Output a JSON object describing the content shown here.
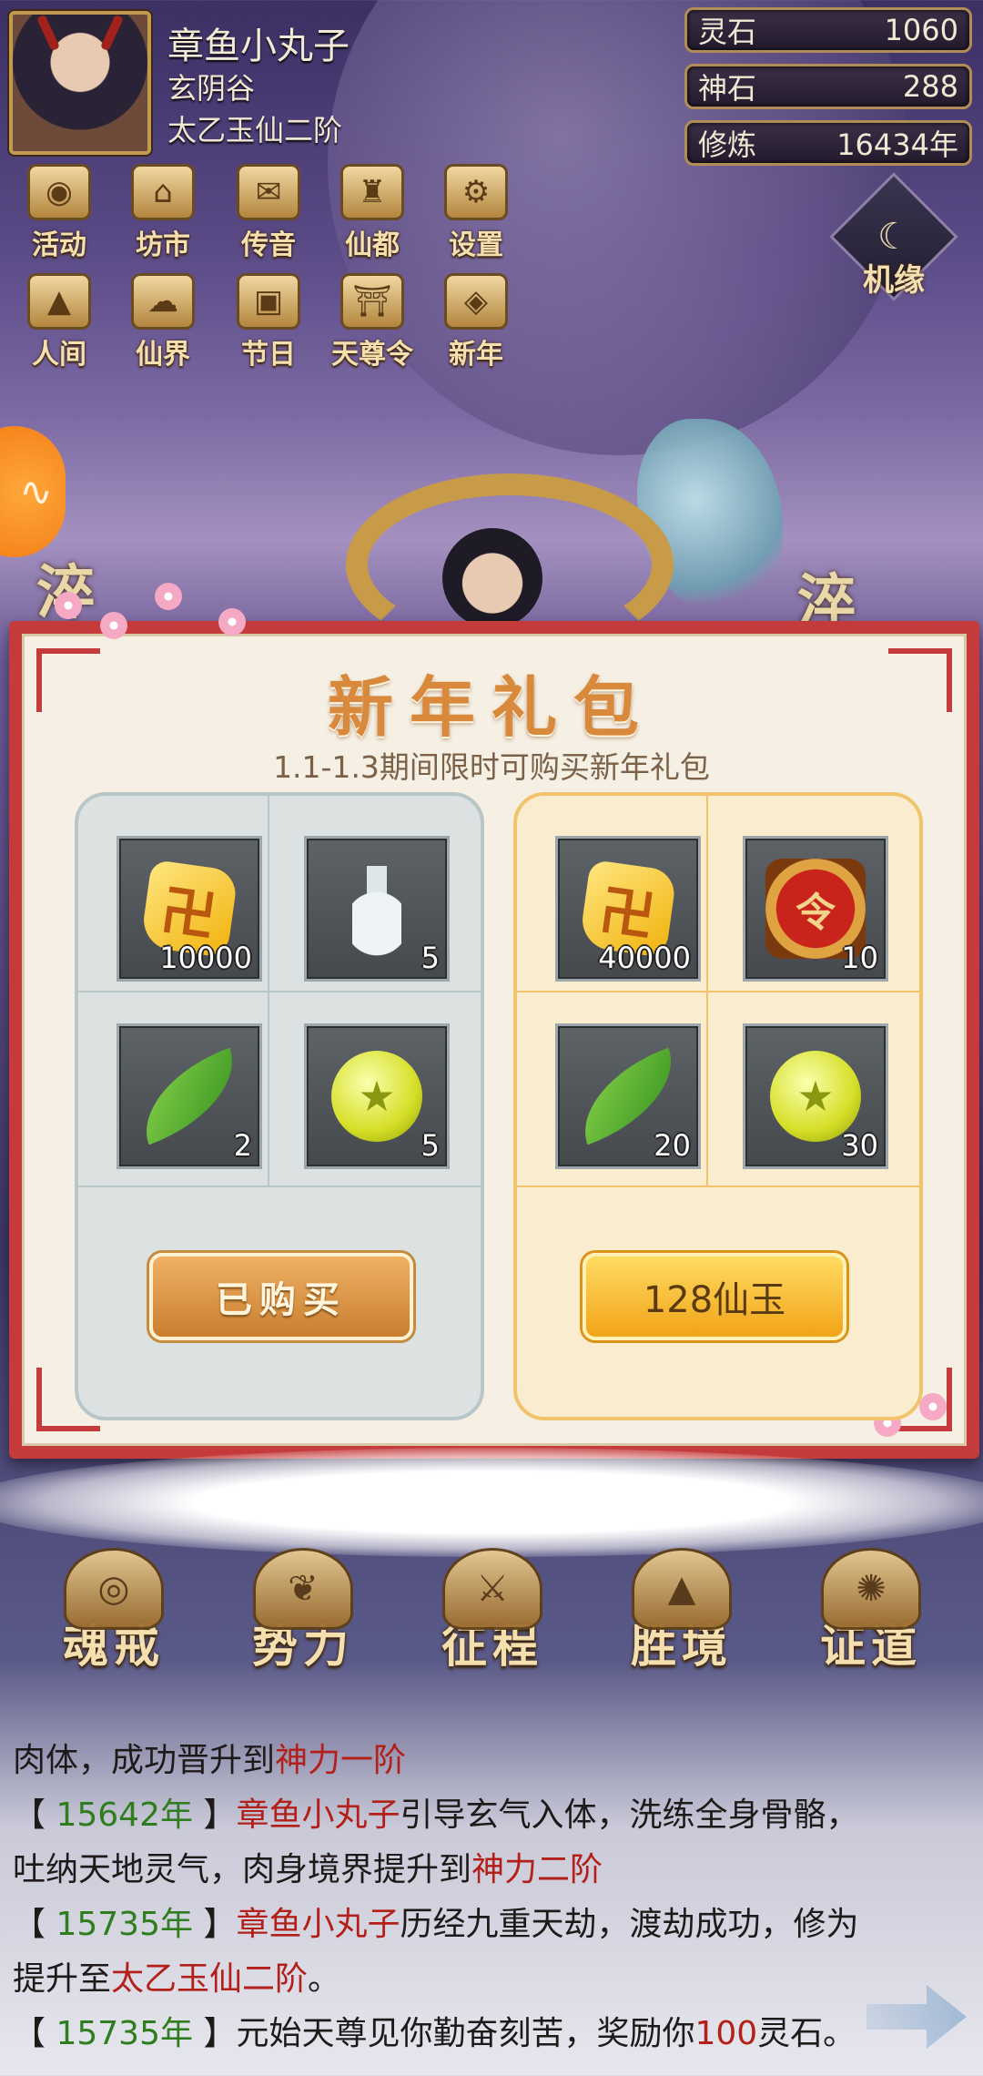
{
  "player": {
    "name": "章鱼小丸子",
    "sect": "玄阴谷",
    "realm": "太乙玉仙二阶"
  },
  "resources": [
    {
      "label": "灵石",
      "value": "1060"
    },
    {
      "label": "神石",
      "value": "288"
    },
    {
      "label": "修炼",
      "value": "16434年"
    }
  ],
  "menu_row1": [
    {
      "label": "活动",
      "icon": "coin-icon"
    },
    {
      "label": "坊市",
      "icon": "market-icon"
    },
    {
      "label": "传音",
      "icon": "envelope-icon"
    },
    {
      "label": "仙都",
      "icon": "pagoda-icon"
    },
    {
      "label": "设置",
      "icon": "gear-icon"
    }
  ],
  "menu_row2": [
    {
      "label": "人间",
      "icon": "mountain-icon"
    },
    {
      "label": "仙界",
      "icon": "cloud-icon"
    },
    {
      "label": "节日",
      "icon": "gift-icon"
    },
    {
      "label": "天尊令",
      "icon": "temple-icon"
    },
    {
      "label": "新年",
      "icon": "scroll-icon"
    }
  ],
  "jiyuan": {
    "label": "机缘",
    "icon": "fate-icon"
  },
  "gift": {
    "title": "新年礼包",
    "subtitle": "1.1-1.3期间限时可购买新年礼包",
    "left_items": [
      {
        "icon": "spirit-stone-icon",
        "count": "10000"
      },
      {
        "icon": "vase-icon",
        "count": "5"
      },
      {
        "icon": "leaf-icon",
        "count": "2"
      },
      {
        "icon": "star-orb-icon",
        "count": "5"
      }
    ],
    "right_items": [
      {
        "icon": "spirit-stone-icon",
        "count": "40000"
      },
      {
        "icon": "command-token-icon",
        "count": "10"
      },
      {
        "icon": "leaf-icon",
        "count": "20"
      },
      {
        "icon": "star-orb-icon",
        "count": "30"
      }
    ],
    "left_button": "已购买",
    "right_button": "128仙玉"
  },
  "bottom_nav": [
    {
      "label": "魂戒",
      "icon": "ring-icon"
    },
    {
      "label": "势力",
      "icon": "wing-icon"
    },
    {
      "label": "征程",
      "icon": "swords-icon"
    },
    {
      "label": "胜境",
      "icon": "peak-icon"
    },
    {
      "label": "证道",
      "icon": "seal-icon"
    }
  ],
  "log": {
    "line1_a": "肉体，成功晋升到",
    "line1_b": "神力一阶",
    "line2_year": "15642年",
    "line2_name": "章鱼小丸子",
    "line2_text": "引导玄气入体，洗练全身骨骼，",
    "line3_a": "吐纳天地灵气，肉身境界提升到",
    "line3_b": "神力二阶",
    "line4_year": "15735年",
    "line4_name": "章鱼小丸子",
    "line4_text": "历经九重天劫，渡劫成功，修为",
    "line5_a": "提升至",
    "line5_b": "太乙玉仙二阶",
    "line5_c": "。",
    "line6_year": "15735年",
    "line6_text": "元始天尊见你勤奋刻苦，奖励你",
    "line6_num": "100",
    "line6_tail": "灵石。"
  },
  "colors": {
    "panel_red": "#c53b3b",
    "year_green": "#2f7d1f",
    "highlight_red": "#b3201a",
    "gold": "#f6dfae"
  }
}
